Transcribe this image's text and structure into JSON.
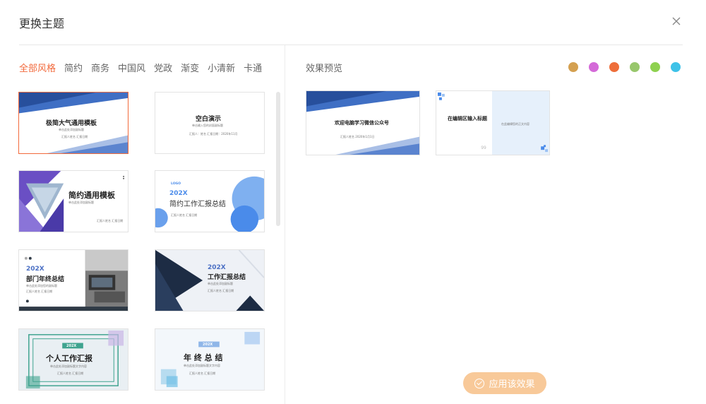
{
  "dialog": {
    "title": "更换主题",
    "close_icon": "close-icon"
  },
  "tabs": [
    {
      "label": "全部风格",
      "active": true
    },
    {
      "label": "简约"
    },
    {
      "label": "商务"
    },
    {
      "label": "中国风"
    },
    {
      "label": "党政"
    },
    {
      "label": "渐变"
    },
    {
      "label": "小清新"
    },
    {
      "label": "卡通"
    }
  ],
  "templates": [
    {
      "title": "极简大气通用模板",
      "subtitle": "单击此处添加副标题",
      "footer": "汇报人姓名    汇报日期"
    },
    {
      "title": "空白演示",
      "subtitle": "单击输入您的封面副标题",
      "footer": "汇报人：姓名    汇报日期：2020年11月"
    },
    {
      "title": "简约通用模板",
      "subtitle": "单击此处添加副标题",
      "footer": "汇报人姓名  汇报日期"
    },
    {
      "title": "简约工作汇报总结",
      "number": "202X",
      "logo": "LOGO",
      "footer": "汇报人姓名  汇报日期"
    },
    {
      "number": "202X",
      "title": "部门年终总结",
      "subtitle": "单击此处添加您的副标题",
      "footer": "汇报人姓名  汇报日期"
    },
    {
      "number": "202X",
      "title": "工作汇报总结",
      "subtitle": "单击此处添加副标题",
      "footer": "汇报人姓名  汇报日期"
    },
    {
      "number": "202X",
      "title": "个人工作汇报",
      "subtitle": "单击此处添加副标题文字内容",
      "footer": "汇报人姓名  汇报日期"
    },
    {
      "number": "202X",
      "title": "年 终 总 结",
      "subtitle": "单击此处添加副标题文字内容",
      "footer": "汇报人姓名  汇报日期"
    }
  ],
  "preview": {
    "label": "效果预览",
    "colors": [
      "#d4a050",
      "#d46ad8",
      "#ee6e3a",
      "#98c76c",
      "#8ed14f",
      "#3ec2e8"
    ],
    "slide1": {
      "title": "欢迎电脑学习微信公众号",
      "footer": "汇报人姓名  2020年1月1日"
    },
    "slide2": {
      "title": "在编辑区输入标题",
      "subtitle": "在此编辑您的正文内容"
    }
  },
  "apply_button": {
    "label": "应用该效果"
  }
}
